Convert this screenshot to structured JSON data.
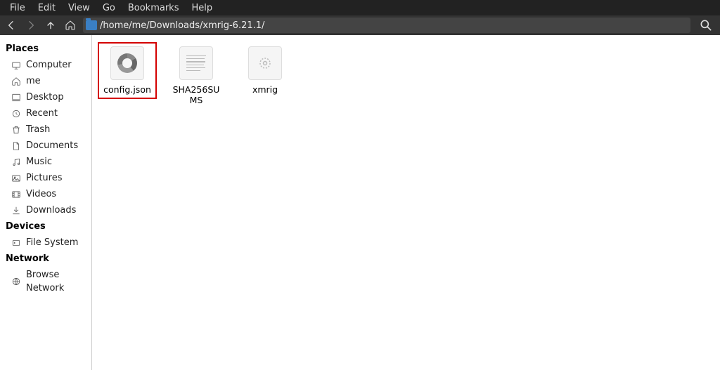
{
  "menubar": [
    "File",
    "Edit",
    "View",
    "Go",
    "Bookmarks",
    "Help"
  ],
  "path": "/home/me/Downloads/xmrig-6.21.1/",
  "sidebar": {
    "sections": [
      {
        "title": "Places",
        "items": [
          {
            "icon": "computer-icon",
            "label": "Computer"
          },
          {
            "icon": "home-icon",
            "label": "me"
          },
          {
            "icon": "desktop-icon",
            "label": "Desktop"
          },
          {
            "icon": "recent-icon",
            "label": "Recent"
          },
          {
            "icon": "trash-icon",
            "label": "Trash"
          },
          {
            "icon": "documents-icon",
            "label": "Documents"
          },
          {
            "icon": "music-icon",
            "label": "Music"
          },
          {
            "icon": "pictures-icon",
            "label": "Pictures"
          },
          {
            "icon": "videos-icon",
            "label": "Videos"
          },
          {
            "icon": "downloads-icon",
            "label": "Downloads"
          }
        ]
      },
      {
        "title": "Devices",
        "items": [
          {
            "icon": "filesystem-icon",
            "label": "File System"
          }
        ]
      },
      {
        "title": "Network",
        "items": [
          {
            "icon": "network-icon",
            "label": "Browse Network"
          }
        ]
      }
    ]
  },
  "files": [
    {
      "name": "config.json",
      "icon": "json",
      "selected": true
    },
    {
      "name": "SHA256SUMS",
      "icon": "text",
      "selected": false
    },
    {
      "name": "xmrig",
      "icon": "exec",
      "selected": false
    }
  ]
}
